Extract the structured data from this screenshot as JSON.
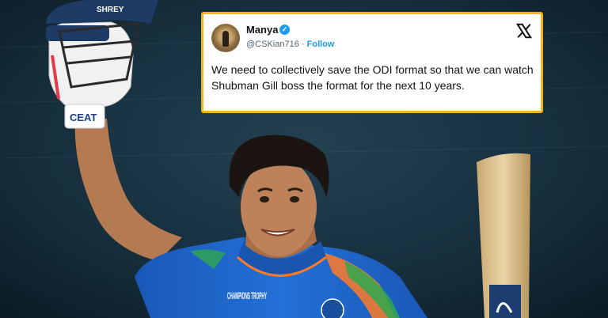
{
  "tweet": {
    "author_name": "Manya",
    "handle": "@CSKian716",
    "separator": "·",
    "follow_label": "Follow",
    "text": "We need to collectively save the ODI format so that we can watch Shubman Gill boss the format for the next 10 years.",
    "verified_icon": "verified-badge-icon",
    "platform_icon": "x-logo-icon"
  },
  "photo": {
    "helmet_text": "SHREY",
    "glove_text": "CEAT",
    "jersey_text": "CHAMPIONS TROPHY"
  },
  "colors": {
    "tweet_border": "#f2b51c",
    "verified_blue": "#1d9bf0",
    "jersey_blue": "#1f66c9"
  }
}
